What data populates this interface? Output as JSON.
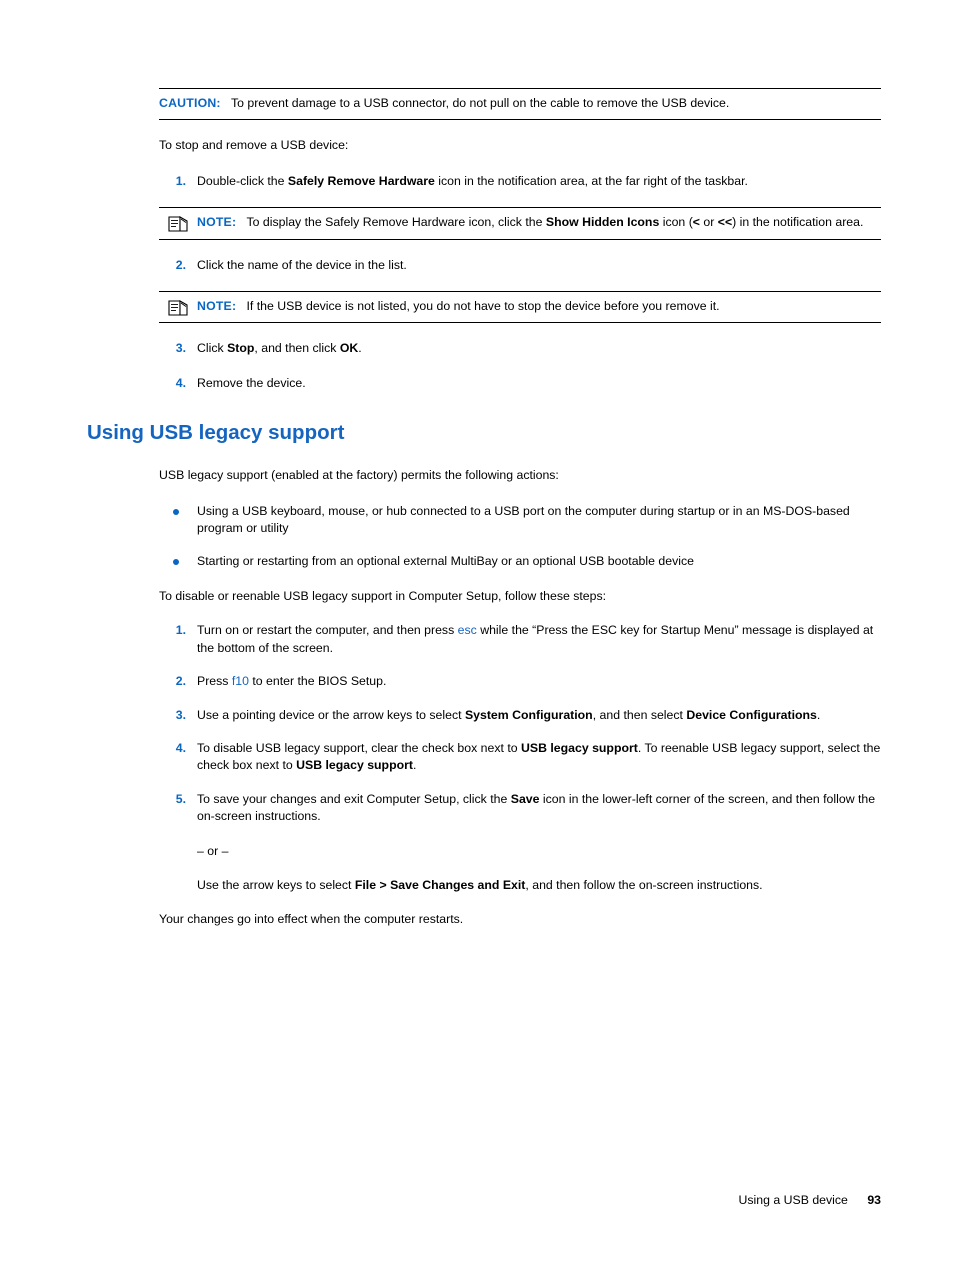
{
  "document": {
    "caution": {
      "label": "CAUTION:",
      "text": "To prevent damage to a USB connector, do not pull on the cable to remove the USB device."
    },
    "intro_para": "To stop and remove a USB device:",
    "steps_one": [
      {
        "num": "1.",
        "parts": [
          {
            "t": "Double-click the ",
            "b": false
          },
          {
            "t": "Safely Remove Hardware",
            "b": true
          },
          {
            "t": " icon in the notification area, at the far right of the taskbar.",
            "b": false
          }
        ]
      },
      {
        "num": "2.",
        "parts": [
          {
            "t": "Click the name of the device in the list.",
            "b": false
          }
        ]
      },
      {
        "num": "3.",
        "parts": [
          {
            "t": "Click ",
            "b": false
          },
          {
            "t": "Stop",
            "b": true
          },
          {
            "t": ", and then click ",
            "b": false
          },
          {
            "t": "OK",
            "b": true
          },
          {
            "t": ".",
            "b": false
          }
        ]
      },
      {
        "num": "4.",
        "parts": [
          {
            "t": "Remove the device.",
            "b": false
          }
        ]
      }
    ],
    "note_one": {
      "label": "NOTE:",
      "parts": [
        {
          "t": "To display the Safely Remove Hardware icon, click the ",
          "b": false
        },
        {
          "t": "Show Hidden Icons",
          "b": true
        },
        {
          "t": " icon (",
          "b": false
        },
        {
          "t": "<",
          "b": true
        },
        {
          "t": " or ",
          "b": false
        },
        {
          "t": "<<",
          "b": true
        },
        {
          "t": ") in the notification area.",
          "b": false
        }
      ]
    },
    "note_two": {
      "label": "NOTE:",
      "parts": [
        {
          "t": "If the USB device is not listed, you do not have to stop the device before you remove it.",
          "b": false
        }
      ]
    },
    "section_title": "Using USB legacy support",
    "section_intro": "USB legacy support (enabled at the factory) permits the following actions:",
    "bullets": [
      "Using a USB keyboard, mouse, or hub connected to a USB port on the computer during startup or in an MS-DOS-based program or utility",
      "Starting or restarting from an optional external MultiBay or an optional USB bootable device"
    ],
    "steps_intro": "To disable or reenable USB legacy support in Computer Setup, follow these steps:",
    "steps_two": [
      {
        "num": "1.",
        "parts": [
          {
            "t": "Turn on or restart the computer, and then press ",
            "b": false
          },
          {
            "t": "esc",
            "b": false,
            "link": true
          },
          {
            "t": " while the “Press the ESC key for Startup Menu” message is displayed at the bottom of the screen.",
            "b": false
          }
        ]
      },
      {
        "num": "2.",
        "parts": [
          {
            "t": "Press ",
            "b": false
          },
          {
            "t": "f10",
            "b": false,
            "link": true
          },
          {
            "t": " to enter the BIOS Setup.",
            "b": false
          }
        ]
      },
      {
        "num": "3.",
        "parts": [
          {
            "t": "Use a pointing device or the arrow keys to select ",
            "b": false
          },
          {
            "t": "System Configuration",
            "b": true
          },
          {
            "t": ", and then select ",
            "b": false
          },
          {
            "t": "Device Configurations",
            "b": true
          },
          {
            "t": ".",
            "b": false
          }
        ]
      },
      {
        "num": "4.",
        "parts": [
          {
            "t": "To disable USB legacy support, clear the check box next to ",
            "b": false
          },
          {
            "t": "USB legacy support",
            "b": true
          },
          {
            "t": ". To reenable USB legacy support, select the check box next to ",
            "b": false
          },
          {
            "t": "USB legacy support",
            "b": true
          },
          {
            "t": ".",
            "b": false
          }
        ]
      },
      {
        "num": "5.",
        "parts": [
          {
            "t": "To save your changes and exit Computer Setup, click the ",
            "b": false
          },
          {
            "t": "Save",
            "b": true
          },
          {
            "t": " icon in the lower-left corner of the screen, and then follow the on-screen instructions.",
            "b": false
          }
        ]
      }
    ],
    "or_separator": "– or –",
    "alt_instruction": [
      {
        "t": "Use the arrow keys to select ",
        "b": false
      },
      {
        "t": "File > Save Changes and Exit",
        "b": true
      },
      {
        "t": ", and then follow the on-screen instructions.",
        "b": false
      }
    ],
    "closing_para": "Your changes go into effect when the computer restarts."
  },
  "footer": {
    "running_head": "Using a USB device",
    "page_number": "93"
  },
  "colors": {
    "accent_blue": "#0a66c2",
    "heading_blue": "#1565c0",
    "text": "#000000"
  }
}
